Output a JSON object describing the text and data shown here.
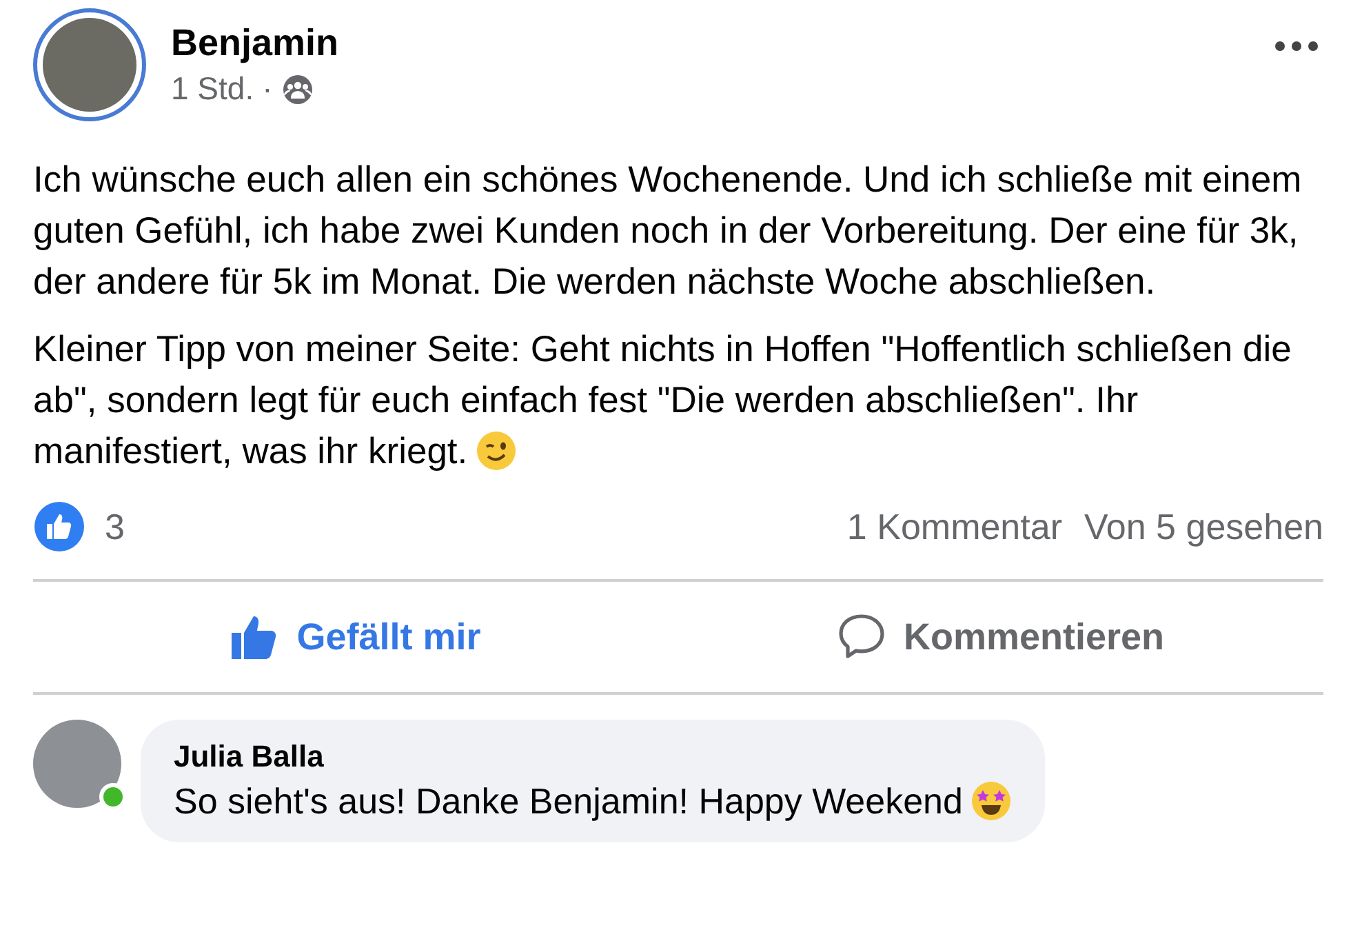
{
  "post": {
    "author": "Benjamin",
    "time": "1 Std.",
    "separator": "·",
    "paragraphs": [
      "Ich wünsche euch allen ein schönes Wochenende. Und ich schließe mit einem guten Gefühl, ich habe zwei Kunden noch in der Vorbereitung. Der eine für 3k, der andere für 5k im Monat. Die werden nächste Woche abschließen.",
      "Kleiner Tipp von meiner Seite: Geht nichts in Hoffen \"Hoffentlich schließen die ab\", sondern legt für euch einfach fest \"Die werden abschließen\". Ihr manifestiert, was ihr kriegt."
    ]
  },
  "stats": {
    "reactions": "3",
    "comments": "1 Kommentar",
    "seen": "Von 5 gesehen"
  },
  "actions": [
    {
      "kind": "like",
      "label": "Gefällt mir",
      "selected": true
    },
    {
      "kind": "comment",
      "label": "Kommentieren",
      "selected": false
    }
  ],
  "comment": {
    "author": "Julia Balla",
    "text": "So sieht's aus! Danke Benjamin! Happy Weekend",
    "online": true
  }
}
